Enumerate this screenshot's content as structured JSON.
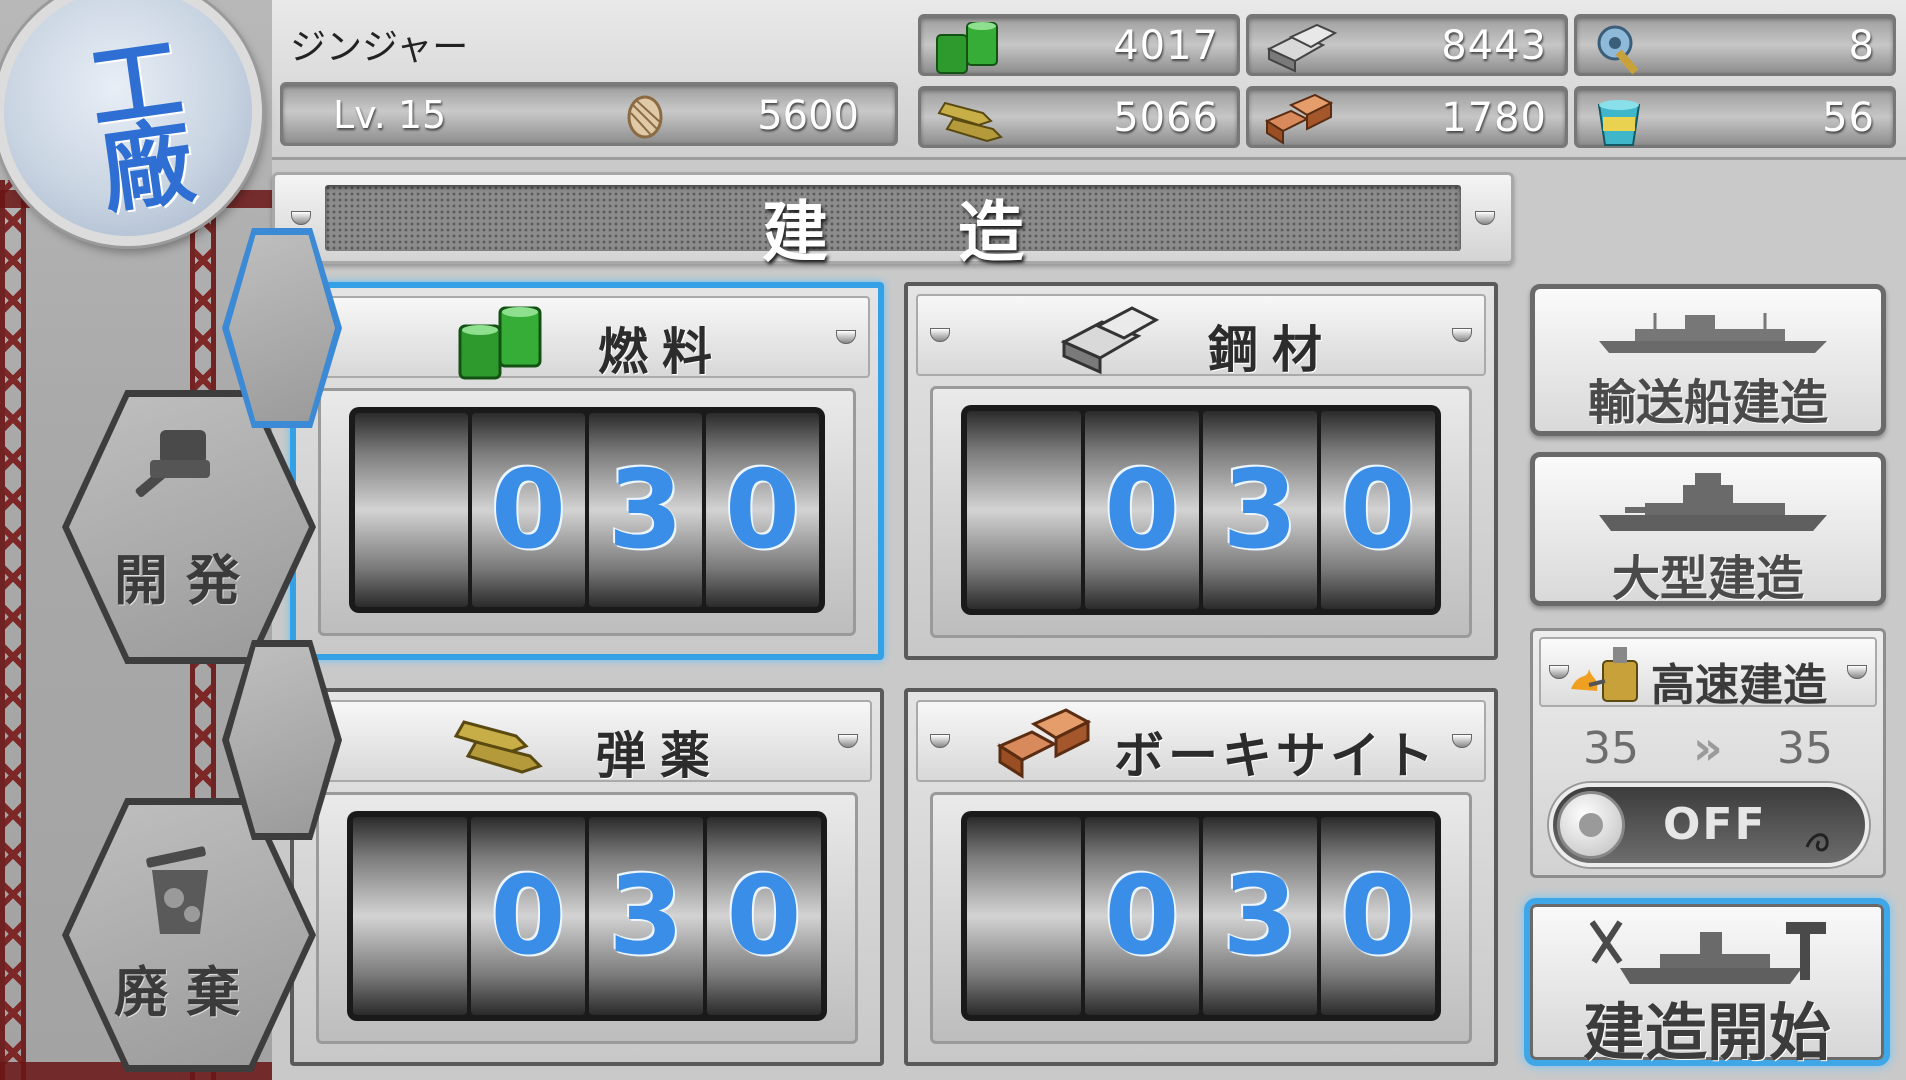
{
  "emblem": {
    "label": "工廠"
  },
  "side_menu": {
    "develop_label": "開発",
    "scrap_label": "廃棄"
  },
  "admiral": {
    "name": "ジンジャー",
    "level": "Lv. 15",
    "coins": "5600"
  },
  "resources": {
    "fuel": "4017",
    "steel": "8443",
    "dev_material": "8",
    "ammo": "5066",
    "bauxite": "1780",
    "repair_bucket": "56"
  },
  "title": "建造",
  "panels": [
    {
      "label": "燃料",
      "digits": [
        "",
        "0",
        "3",
        "0"
      ]
    },
    {
      "label": "鋼材",
      "digits": [
        "",
        "0",
        "3",
        "0"
      ]
    },
    {
      "label": "弾薬",
      "digits": [
        "",
        "0",
        "3",
        "0"
      ]
    },
    {
      "label": "ボーキサイト",
      "digits": [
        "",
        "0",
        "3",
        "0"
      ]
    }
  ],
  "buttons": {
    "transport": "輸送船建造",
    "large": "大型建造",
    "start": "建造開始"
  },
  "fast_build": {
    "label": "高速建造",
    "from": "35",
    "arrow": "»",
    "to": "35",
    "toggle": "OFF"
  },
  "colors": {
    "selected_border": "#34a0e6",
    "digit": "#3a8ee8",
    "fuel": "#2e9a2e",
    "steel": "#a9a9a9",
    "ammo": "#b49a3a",
    "bauxite": "#b5683c",
    "girder": "#7a1a1a"
  },
  "icons": {
    "fuel": "fuel-drums-icon",
    "steel": "steel-ingots-icon",
    "ammo": "ammo-shells-icon",
    "bauxite": "bauxite-blocks-icon",
    "dev_material": "dev-material-icon",
    "repair_bucket": "repair-bucket-icon",
    "coin": "furniture-coin-icon",
    "fast_build": "burner-icon"
  }
}
